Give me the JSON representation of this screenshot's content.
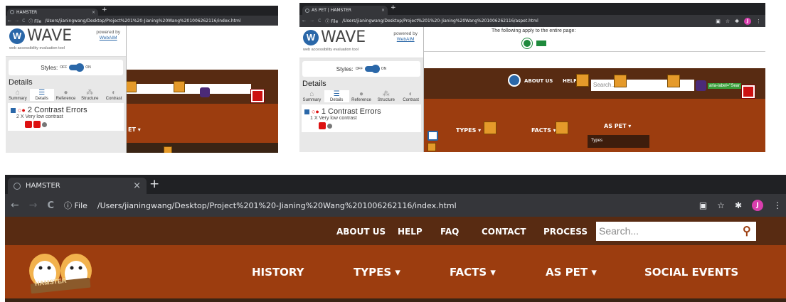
{
  "shot1": {
    "tab_title": "HAMSTER",
    "tab_close": "×",
    "new_tab": "+",
    "nav_back": "←",
    "nav_forward": "→",
    "nav_reload": "C",
    "file_label": "ⓘ File",
    "url": "/Users/jianingwang/Desktop/Project%201%20-Jianing%20Wang%201006262116/index.html",
    "wave": {
      "title": "WAVE",
      "subtitle": "web accessibility evaluation tool",
      "powered_by": "powered by",
      "webaim": "WebAIM",
      "styles_label": "Styles:",
      "off": "OFF",
      "on": "ON",
      "details_heading": "Details",
      "tabs": [
        "Summary",
        "Details",
        "Reference",
        "Structure",
        "Contrast"
      ],
      "error_title": "2 Contrast Errors",
      "error_sub": "2 X Very low contrast"
    },
    "menu_fragment": "ET ▾"
  },
  "shot2": {
    "tab_title": "AS PET | HAMSTER",
    "tab_close": "×",
    "new_tab": "+",
    "nav_back": "←",
    "nav_forward": "→",
    "nav_reload": "C",
    "file_label": "ⓘ File",
    "url": "/Users/jianingwang/Desktop/Project%201%20-Jianing%20Wang%201006262116/aspet.html",
    "avatar": "J",
    "page_notice": "The following apply to the entire page:",
    "wave": {
      "title": "WAVE",
      "subtitle": "web accessibility evaluation tool",
      "powered_by": "powered by",
      "webaim": "WebAIM",
      "styles_label": "Styles:",
      "off": "OFF",
      "on": "ON",
      "details_heading": "Details",
      "tabs": [
        "Summary",
        "Details",
        "Reference",
        "Structure",
        "Contrast"
      ],
      "error_title": "1 Contrast Errors",
      "error_sub": "1 X Very low contrast"
    },
    "menu_about": "ABOUT US",
    "menu_help": "HELP",
    "search_placeholder": "Search...",
    "aria_label": "aria-label=\"Sear",
    "menu_types": "TYPES ▾",
    "menu_facts": "FACTS ▾",
    "menu_aspet": "AS PET ▾",
    "dropdown_item": "Types"
  },
  "shot3": {
    "tab_title": "HAMSTER",
    "tab_close": "×",
    "new_tab": "+",
    "nav_back": "←",
    "nav_forward": "→",
    "nav_reload": "C",
    "file_label": "ⓘ File",
    "url": "/Users/jianingwang/Desktop/Project%201%20-Jianing%20Wang%201006262116/index.html",
    "avatar": "J",
    "top_menu": [
      "ABOUT US",
      "HELP",
      "FAQ",
      "CONTACT",
      "PROCESS"
    ],
    "search_placeholder": "Search...",
    "main_menu": [
      "HISTORY",
      "TYPES ▾",
      "FACTS ▾",
      "AS PET ▾",
      "SOCIAL EVENTS"
    ],
    "logo_text": "HAMSTER"
  },
  "colors": {
    "chrome_dark": "#202124",
    "chrome_bar": "#35363a",
    "site_brown": "#582b12",
    "site_orange": "#9c3d0f",
    "wave_blue": "#2a67a8"
  }
}
